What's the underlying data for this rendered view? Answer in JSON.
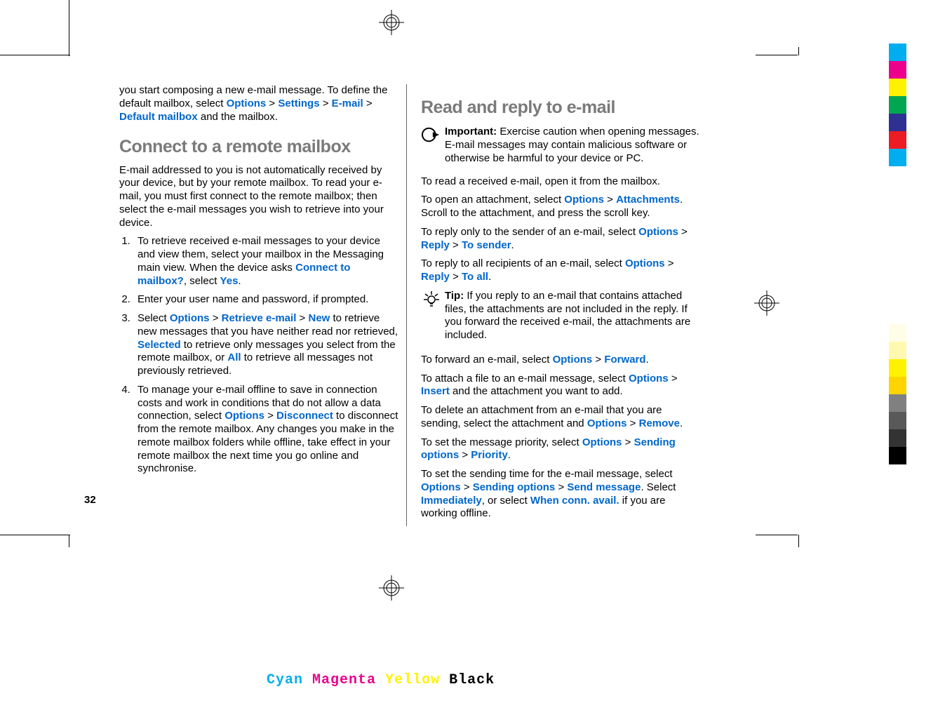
{
  "page_number": "32",
  "col_left": {
    "intro": {
      "t1": "you start composing a new e-mail message. To define the default mailbox, select ",
      "l1": "Options",
      "g1": " > ",
      "l2": "Settings",
      "g2": " > ",
      "l3": "E-mail",
      "g3": " > ",
      "l4": "Default mailbox",
      "t2": " and the mailbox."
    },
    "h1": "Connect to a remote mailbox",
    "p1": "E-mail addressed to you is not automatically received by your device, but by your remote mailbox. To read your e-mail, you must first connect to the remote mailbox; then select the e-mail messages you wish to retrieve into your device.",
    "li1": {
      "t1": "To retrieve received e-mail messages to your device and view them, select your mailbox in the Messaging main view. When the device asks ",
      "l1": "Connect to mailbox?",
      "t2": ", select ",
      "l2": "Yes",
      "t3": "."
    },
    "li2": {
      "t1": "Enter your user name and password, if prompted."
    },
    "li3": {
      "t1": "Select ",
      "l1": "Options",
      "g1": " > ",
      "l2": "Retrieve e-mail",
      "g2": " > ",
      "l3": "New",
      "t2": " to retrieve new messages that you have neither read nor retrieved, ",
      "l4": "Selected",
      "t3": " to retrieve only messages you select from the remote mailbox, or ",
      "l5": "All",
      "t4": " to retrieve all messages not previously retrieved."
    },
    "li4": {
      "t1": "To manage your e-mail offline to save in connection costs and work in conditions that do not allow a data connection, select ",
      "l1": "Options",
      "g1": " > ",
      "l2": "Disconnect",
      "t2": " to disconnect from the remote mailbox. Any changes you make in the remote mailbox folders while offline, take effect in your remote mailbox the next time you go online and synchronise."
    }
  },
  "col_right": {
    "h1": "Read and reply to e-mail",
    "important": {
      "label": "Important:",
      "t1": "  Exercise caution when opening messages. E-mail messages may contain malicious software or otherwise be harmful to your device or PC."
    },
    "p1": "To read a received e-mail, open it from the mailbox.",
    "p2": {
      "t1": "To open an attachment, select ",
      "l1": "Options",
      "g1": " > ",
      "l2": "Attachments",
      "t2": ". Scroll to the attachment, and press the scroll key."
    },
    "p3": {
      "t1": "To reply only to the sender of an e-mail, select ",
      "l1": "Options",
      "g1": " > ",
      "l2": "Reply",
      "g2": " > ",
      "l3": "To sender",
      "t2": "."
    },
    "p4": {
      "t1": "To reply to all recipients of an e-mail, select ",
      "l1": "Options",
      "g1": " > ",
      "l2": "Reply",
      "g2": " > ",
      "l3": "To all",
      "t2": "."
    },
    "tip": {
      "label": "Tip:",
      "t1": " If you reply to an e-mail that contains attached files, the attachments are not included in the reply. If you forward the received e-mail, the attachments are included."
    },
    "p5": {
      "t1": "To forward an e-mail, select ",
      "l1": "Options",
      "g1": " > ",
      "l2": "Forward",
      "t2": "."
    },
    "p6": {
      "t1": "To attach a file to an e-mail message, select ",
      "l1": "Options",
      "g1": " > ",
      "l2": "Insert",
      "t2": " and the attachment you want to add."
    },
    "p7": {
      "t1": "To delete an attachment from an e-mail that you are sending, select the attachment and ",
      "l1": "Options",
      "g1": " > ",
      "l2": "Remove",
      "t2": "."
    },
    "p8": {
      "t1": "To set the message priority, select ",
      "l1": "Options",
      "g1": " > ",
      "l2": "Sending options",
      "g2": " > ",
      "l3": "Priority",
      "t2": "."
    },
    "p9": {
      "t1": "To set the sending time for the e-mail message, select ",
      "l1": "Options",
      "g1": " > ",
      "l2": "Sending options",
      "g2": " > ",
      "l3": "Send message",
      "t2": ". Select ",
      "l4": "Immediately",
      "t3": ", or select ",
      "l5": "When conn. avail.",
      "t4": " if you are working offline."
    }
  },
  "cmyk": {
    "c": "Cyan",
    "m": "Magenta",
    "y": "Yellow",
    "k": "Black"
  },
  "print_colors_top": [
    "#00aeef",
    "#ec008c",
    "#fff200",
    "#00a651",
    "#2e3192",
    "#ed1c24",
    "#00aeef"
  ],
  "print_colors_bot": [
    "#fffde6",
    "#fff9b0",
    "#fff200",
    "#ffd400",
    "#808080",
    "#595959",
    "#333333",
    "#000000"
  ]
}
